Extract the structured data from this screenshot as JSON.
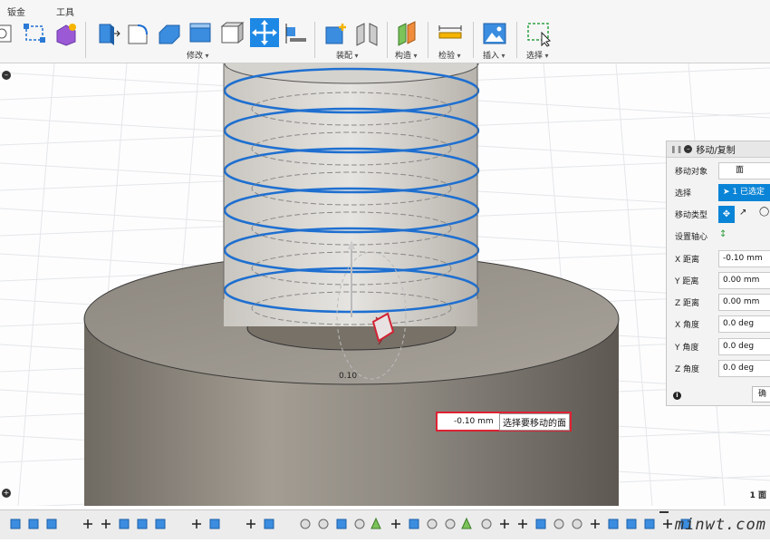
{
  "toolbar": {
    "tabs": [
      "钣金",
      "工具"
    ],
    "groups": [
      "修改",
      "装配",
      "构造",
      "检验",
      "插入",
      "选择"
    ]
  },
  "viewport": {
    "dimension_label": "0.10",
    "hud": {
      "value": "-0.10 mm",
      "tooltip": "选择要移动的面"
    },
    "face_count": "1 面"
  },
  "panel": {
    "title": "移动/复制",
    "rows": [
      {
        "label": "移动对象",
        "value": "面"
      },
      {
        "label": "选择",
        "value": "1 已选定"
      },
      {
        "label": "移动类型",
        "value": ""
      },
      {
        "label": "设置轴心",
        "value": ""
      },
      {
        "label": "X 距离",
        "value": "-0.10 mm"
      },
      {
        "label": "Y 距离",
        "value": "0.00 mm"
      },
      {
        "label": "Z 距离",
        "value": "0.00 mm"
      },
      {
        "label": "X 角度",
        "value": "0.0 deg"
      },
      {
        "label": "Y 角度",
        "value": "0.0 deg"
      },
      {
        "label": "Z 角度",
        "value": "0.0 deg"
      }
    ],
    "ok_label": "确"
  },
  "watermark": "minwt.com",
  "colors": {
    "selection_blue": "#1e6fd0",
    "highlight_red": "#d22233",
    "body_gray": "#8a857d",
    "panel_bg": "#f3f3f3"
  }
}
